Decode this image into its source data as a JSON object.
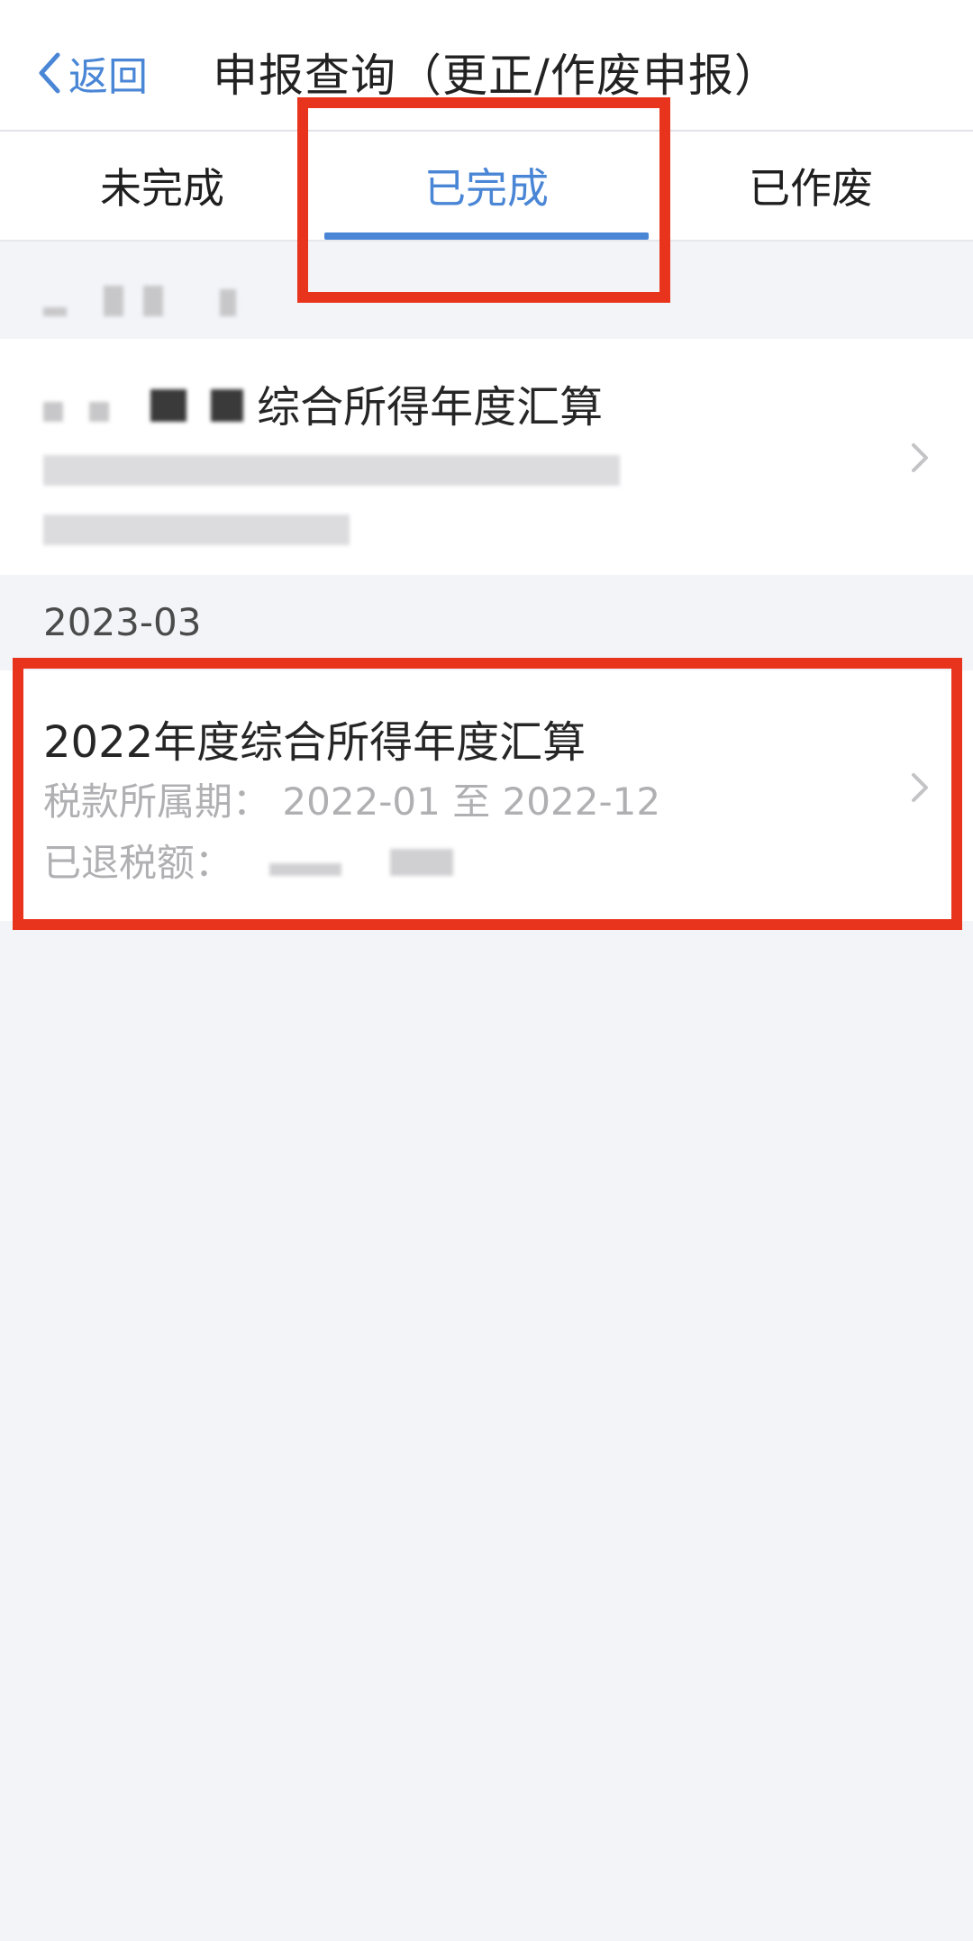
{
  "header": {
    "back_label": "返回",
    "title": "申报查询（更正/作废申报）"
  },
  "tabs": [
    {
      "label": "未完成",
      "active": false
    },
    {
      "label": "已完成",
      "active": true
    },
    {
      "label": "已作废",
      "active": false
    }
  ],
  "records": {
    "first_item": {
      "title_suffix": "综合所得年度汇算"
    },
    "second_section": {
      "month": "2023-03",
      "title": "2022年度综合所得年度汇算",
      "period_label": "税款所属期：",
      "period_value": "2022-01 至 2022-12",
      "refund_label": "已退税额："
    }
  },
  "colors": {
    "accent": "#4a86d6",
    "highlight": "#e8341c",
    "background": "#f3f4f8"
  },
  "icons": {
    "back": "chevron-left-icon",
    "row_arrow": "chevron-right-icon"
  }
}
